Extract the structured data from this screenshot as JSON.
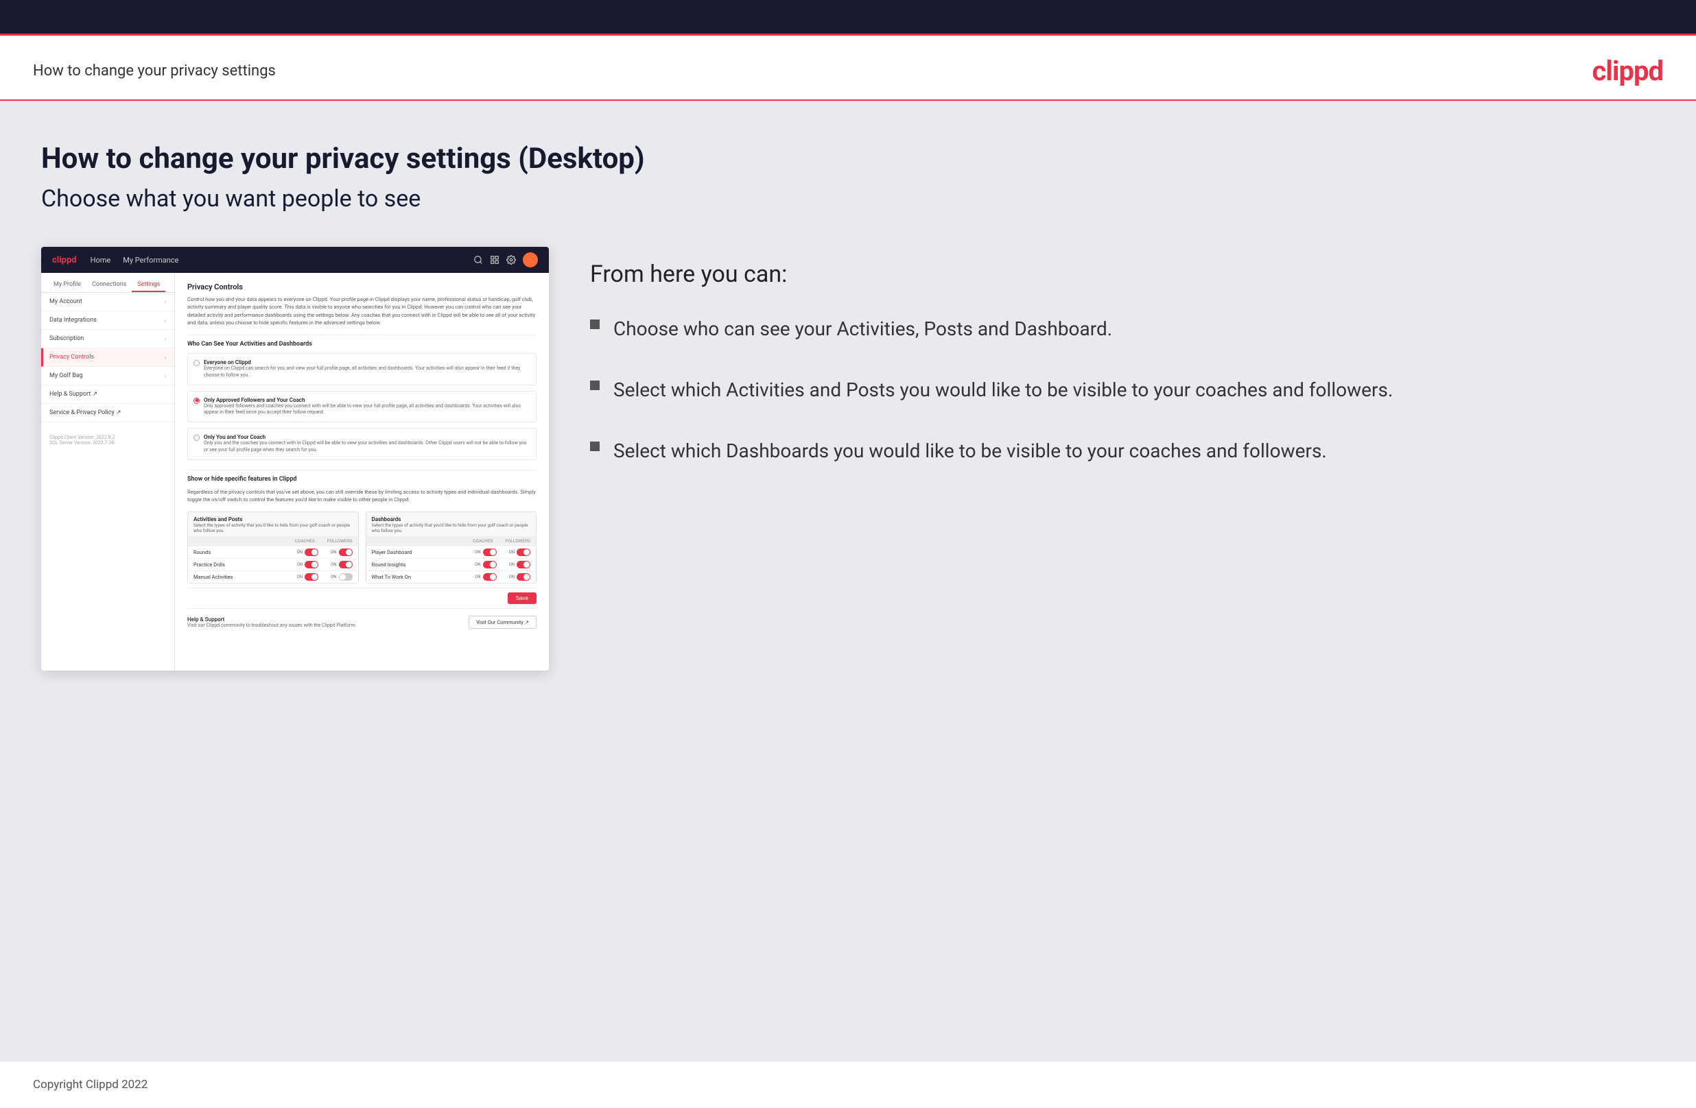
{
  "header": {
    "title": "How to change your privacy settings",
    "logo": "clippd"
  },
  "main": {
    "content_title": "How to change your privacy settings (Desktop)",
    "content_subtitle": "Choose what you want people to see"
  },
  "mock_app": {
    "logo": "clippd",
    "nav_links": [
      "Home",
      "My Performance"
    ],
    "tabs": [
      "My Profile",
      "Connections",
      "Settings"
    ],
    "active_tab": "Settings",
    "sidebar_items": [
      {
        "label": "My Account",
        "active": false
      },
      {
        "label": "Data Integrations",
        "active": false
      },
      {
        "label": "Subscription",
        "active": false
      },
      {
        "label": "Privacy Controls",
        "active": true
      },
      {
        "label": "My Golf Bag",
        "active": false
      },
      {
        "label": "Help & Support",
        "active": false
      },
      {
        "label": "Service & Privacy Policy",
        "active": false
      }
    ],
    "version_text": "Clippd Client Version: 2022.8.2\nSQL Server Version: 2022.7.38",
    "privacy_controls": {
      "section_title": "Privacy Controls",
      "section_desc": "Control how you and your data appears to everyone on Clippd. Your profile page in Clippd displays your name, professional status or handicap, golf club, activity summary and player quality score. This data is visible to anyone who searches for you in Clippd. However you can control who can see your detailed activity and performance dashboards using the settings below. Any coaches that you connect with in Clippd will be able to see all of your activity and data, unless you choose to hide specific features in the advanced settings below.",
      "who_can_see_title": "Who Can See Your Activities and Dashboards",
      "radio_options": [
        {
          "label": "Everyone on Clippd",
          "desc": "Everyone on Clippd can search for you and view your full profile page, all activities and dashboards. Your activities will also appear in their feed if they choose to follow you.",
          "selected": false
        },
        {
          "label": "Only Approved Followers and Your Coach",
          "desc": "Only approved followers and coaches you connect with will be able to view your full profile page, all activities and dashboards. Your activities will also appear in their feed once you accept their follow request.",
          "selected": true
        },
        {
          "label": "Only You and Your Coach",
          "desc": "Only you and the coaches you connect with in Clippd will be able to view your activities and dashboards. Other Clippd users will not be able to follow you or see your full profile page when they search for you.",
          "selected": false
        }
      ],
      "show_hide_title": "Show or hide specific features in Clippd",
      "show_hide_desc": "Regardless of the privacy controls that you've set above, you can still override these by limiting access to activity types and individual dashboards. Simply toggle the on/off switch to control the features you'd like to make visible to other people in Clippd.",
      "activities_posts": {
        "title": "Activities and Posts",
        "desc": "Select the types of activity that you'd like to hide from your golf coach or people who follow you.",
        "col_coaches": "COACHES",
        "col_followers": "FOLLOWERS",
        "rows": [
          {
            "label": "Rounds",
            "coaches": true,
            "followers": true
          },
          {
            "label": "Practice Drills",
            "coaches": true,
            "followers": true
          },
          {
            "label": "Manual Activities",
            "coaches": true,
            "followers": false
          }
        ]
      },
      "dashboards": {
        "title": "Dashboards",
        "desc": "Select the types of activity that you'd like to hide from your golf coach or people who follow you.",
        "col_coaches": "COACHES",
        "col_followers": "FOLLOWERS",
        "rows": [
          {
            "label": "Player Dashboard",
            "coaches": true,
            "followers": true
          },
          {
            "label": "Round Insights",
            "coaches": true,
            "followers": true
          },
          {
            "label": "What To Work On",
            "coaches": true,
            "followers": true
          }
        ]
      },
      "save_label": "Save",
      "help_support": {
        "title": "Help & Support",
        "desc": "Visit our Clippd community to troubleshoot any issues with the Clippd Platform.",
        "visit_btn": "Visit Our Community"
      }
    }
  },
  "right_panel": {
    "from_here_title": "From here you can:",
    "bullets": [
      "Choose who can see your Activities, Posts and Dashboard.",
      "Select which Activities and Posts you would like to be visible to your coaches and followers.",
      "Select which Dashboards you would like to be visible to your coaches and followers."
    ]
  },
  "footer": {
    "copyright": "Copyright Clippd 2022"
  }
}
